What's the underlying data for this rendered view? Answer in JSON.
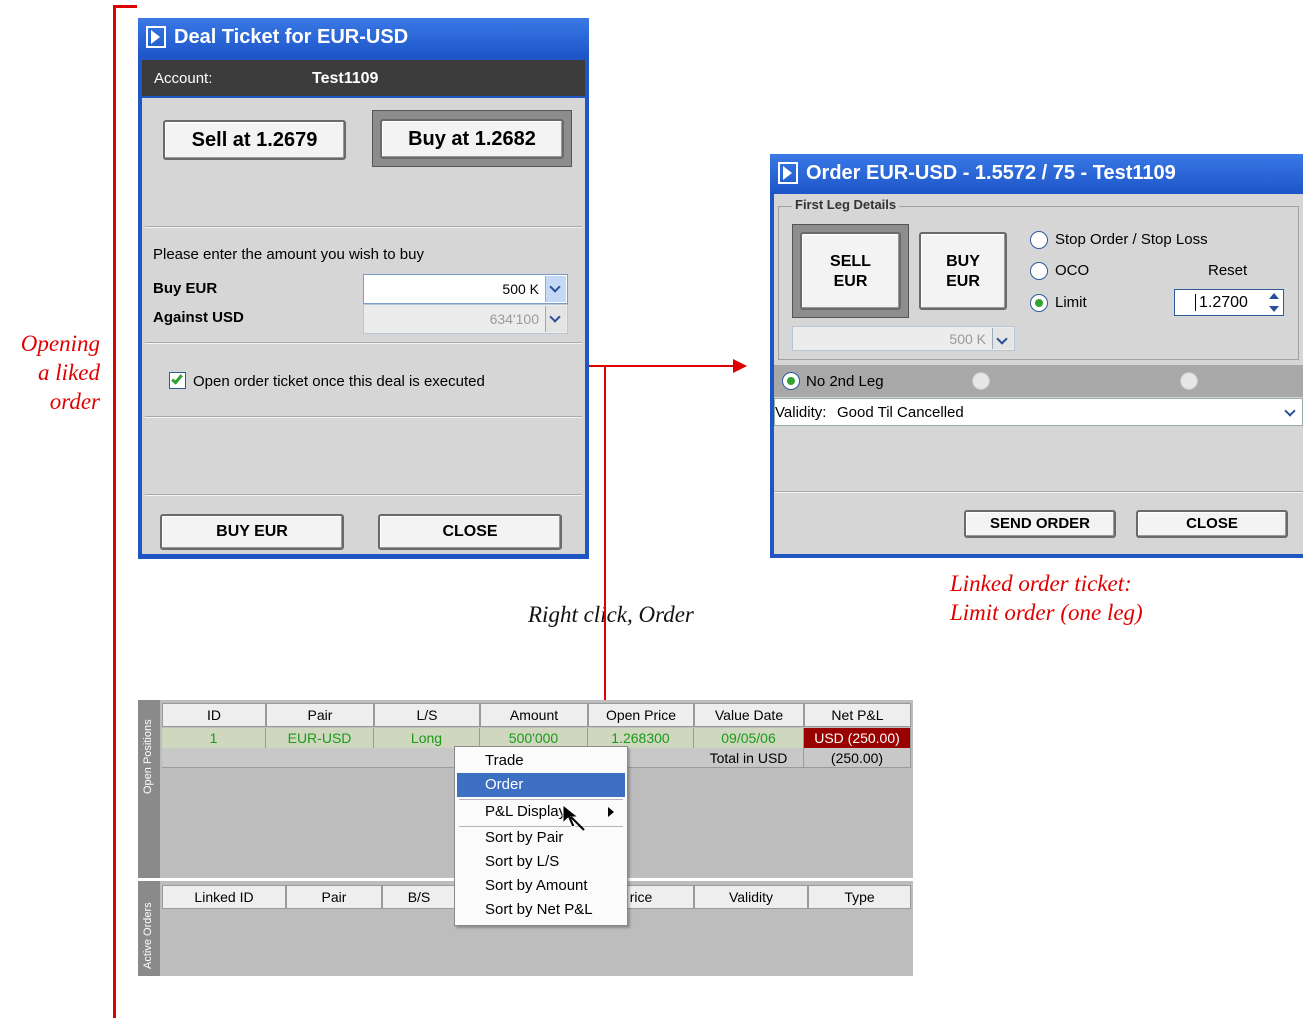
{
  "annotations": {
    "opening_lines": [
      "Opening",
      "a liked",
      "order"
    ],
    "right_click": "Right click, Order",
    "linked_lines": [
      "Linked order ticket:",
      "Limit order (one leg)"
    ]
  },
  "deal_ticket": {
    "title": "Deal Ticket for EUR-USD",
    "account_label": "Account:",
    "account_value": "Test1109",
    "sell_button": "Sell at 1.2679",
    "buy_button": "Buy at 1.2682",
    "prompt": "Please enter the amount you wish to buy",
    "buy_label": "Buy EUR",
    "buy_amount": "500 K",
    "against_label": "Against USD",
    "against_amount": "634'100",
    "checkbox_label": "Open order ticket once this deal is executed",
    "checkbox_checked": true,
    "confirm_button": "BUY EUR",
    "close_button": "CLOSE"
  },
  "order_ticket": {
    "title": "Order EUR-USD - 1.5572 / 75 - Test1109",
    "group_label": "First Leg Details",
    "sell_lines": [
      "SELL",
      "EUR"
    ],
    "buy_lines": [
      "BUY",
      "EUR"
    ],
    "amount": "500 K",
    "radio_stop": "Stop Order / Stop Loss",
    "radio_oco": "OCO",
    "radio_limit": "Limit",
    "reset_label": "Reset",
    "limit_value": "1.2700",
    "second_leg_option": "No 2nd Leg",
    "validity_label": "Validity:",
    "validity_value": "Good Til Cancelled",
    "send_button": "SEND ORDER",
    "close_button": "CLOSE"
  },
  "positions": {
    "tab_label": "Open Positions",
    "headers": [
      "ID",
      "Pair",
      "L/S",
      "Amount",
      "Open Price",
      "Value Date",
      "Net P&L"
    ],
    "row": [
      "1",
      "EUR-USD",
      "Long",
      "500'000",
      "1.268300",
      "09/05/06",
      "USD (250.00)"
    ],
    "total_label": "Total in USD",
    "total_value": "(250.00)"
  },
  "orders": {
    "tab_label": "Active Orders",
    "headers": [
      "Linked ID",
      "Pair",
      "B/S",
      "rice",
      "Validity",
      "Type"
    ]
  },
  "context_menu": {
    "items": [
      "Trade",
      "Order",
      "P&L Display...",
      "Sort by Pair",
      "Sort by L/S",
      "Sort by Amount",
      "Sort by Net P&L"
    ],
    "selected": "Order"
  },
  "colors": {
    "title_blue": "#1d55c8",
    "annotation_red": "#e00000",
    "row_green": "#1a9a1a",
    "loss_red": "#990000",
    "menu_highlight": "#3d6fc2"
  }
}
